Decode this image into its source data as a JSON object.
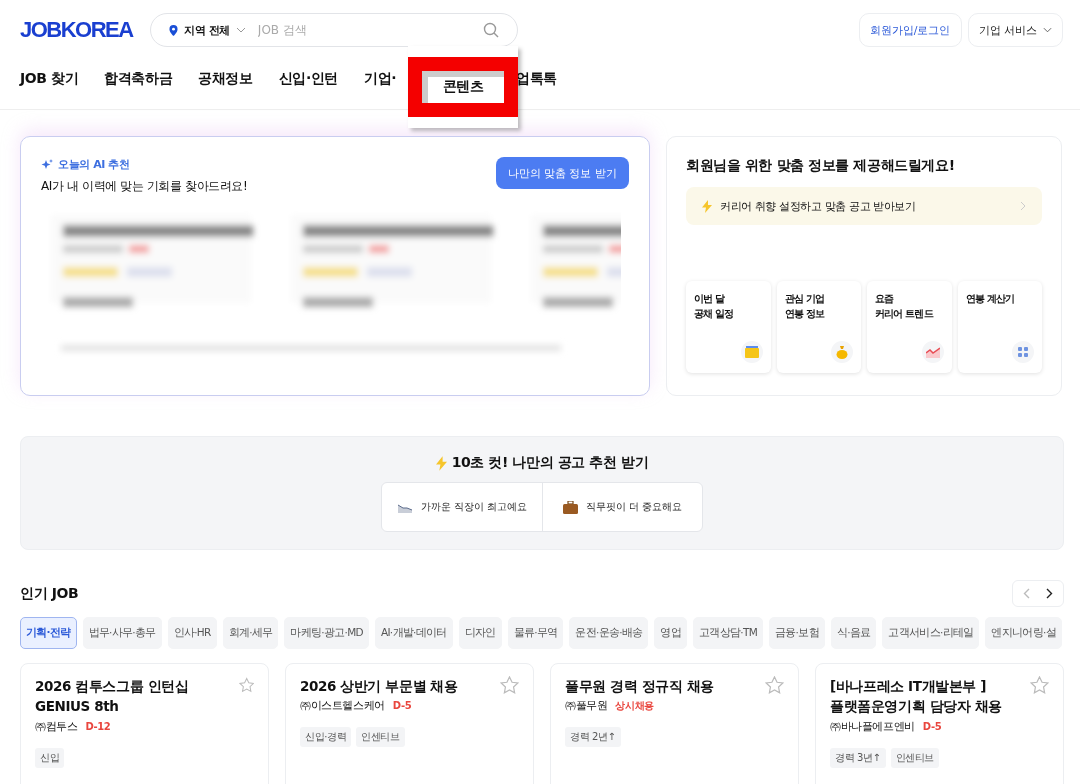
{
  "header": {
    "logo": "JOBKOREA",
    "region": "지역 전체",
    "search_placeholder": "JOB 검색",
    "login": "회원가입/로그인",
    "business": "기업 서비스"
  },
  "nav": [
    {
      "label": "JOB 찾기",
      "kind": "plain"
    },
    {
      "label": "합격축하금",
      "kind": "plain"
    },
    {
      "label": "공채정보",
      "kind": "plain"
    },
    {
      "label": "신입·인턴",
      "kind": "plain"
    },
    {
      "label": "기업·",
      "kind": "plain"
    },
    {
      "label": "콘텐츠",
      "kind": "highlighted"
    },
    {
      "label": "업톡톡",
      "kind": "plain"
    }
  ],
  "ai": {
    "tag": "오늘의 AI 추천",
    "text": "AI가 내 이력에 맞는 기회를 찾아드려요!",
    "button": "나만의 맞춤 정보 받기"
  },
  "custom": {
    "title": "회원님을 위한 맞춤 정보를 제공해드릴게요!",
    "banner": "커리어 취향 설정하고 맞춤 공고 받아보기",
    "tiles": [
      {
        "label": "이번 달\n공채 일정",
        "kind": "calendar"
      },
      {
        "label": "관심 기업\n연봉 정보",
        "kind": "money"
      },
      {
        "label": "요즘\n커리어 트렌드",
        "kind": "trend"
      },
      {
        "label": "연봉 계산기",
        "kind": "calculator"
      }
    ]
  },
  "quick": {
    "title": "10초 컷! 나만의 공고 추천 받기",
    "options": [
      {
        "label": "가까운 직장이 최고예요",
        "kind": "shoe"
      },
      {
        "label": "직무핏이 더 중요해요",
        "kind": "briefcase"
      }
    ]
  },
  "popular": {
    "title": "인기 JOB",
    "chips": [
      {
        "label": "기획·전략",
        "selected": true
      },
      {
        "label": "법무·사무·총무",
        "selected": false
      },
      {
        "label": "인사·HR",
        "selected": false
      },
      {
        "label": "회계·세무",
        "selected": false
      },
      {
        "label": "마케팅·광고·MD",
        "selected": false
      },
      {
        "label": "AI·개발·데이터",
        "selected": false
      },
      {
        "label": "디자인",
        "selected": false
      },
      {
        "label": "물류·무역",
        "selected": false
      },
      {
        "label": "운전·운송·배송",
        "selected": false
      },
      {
        "label": "영업",
        "selected": false
      },
      {
        "label": "고객상담·TM",
        "selected": false
      },
      {
        "label": "금융·보험",
        "selected": false
      },
      {
        "label": "식·음료",
        "selected": false
      },
      {
        "label": "고객서비스·리테일",
        "selected": false
      },
      {
        "label": "엔지니어링·설",
        "selected": false
      }
    ],
    "jobs": [
      {
        "title": "2026 컴투스그룹 인턴십 GENIUS 8th",
        "company": "㈜컴투스",
        "deadline": "D-12",
        "tags": [
          "신입"
        ]
      },
      {
        "title": "2026 상반기 부문별 채용",
        "company": "㈜이스트헬스케어",
        "deadline": "D-5",
        "tags": [
          "신입·경력",
          "인센티브"
        ]
      },
      {
        "title": "풀무원 경력 정규직 채용",
        "company": "㈜풀무원",
        "deadline": "상시채용",
        "tags": [
          "경력 2년↑"
        ]
      },
      {
        "title": "[바나프레소 IT개발본부 ]\n플랫폼운영기획 담당자 채용",
        "company": "㈜바나플에프엔비",
        "deadline": "D-5",
        "tags": [
          "경력 3년↑",
          "인센티브"
        ]
      }
    ]
  }
}
